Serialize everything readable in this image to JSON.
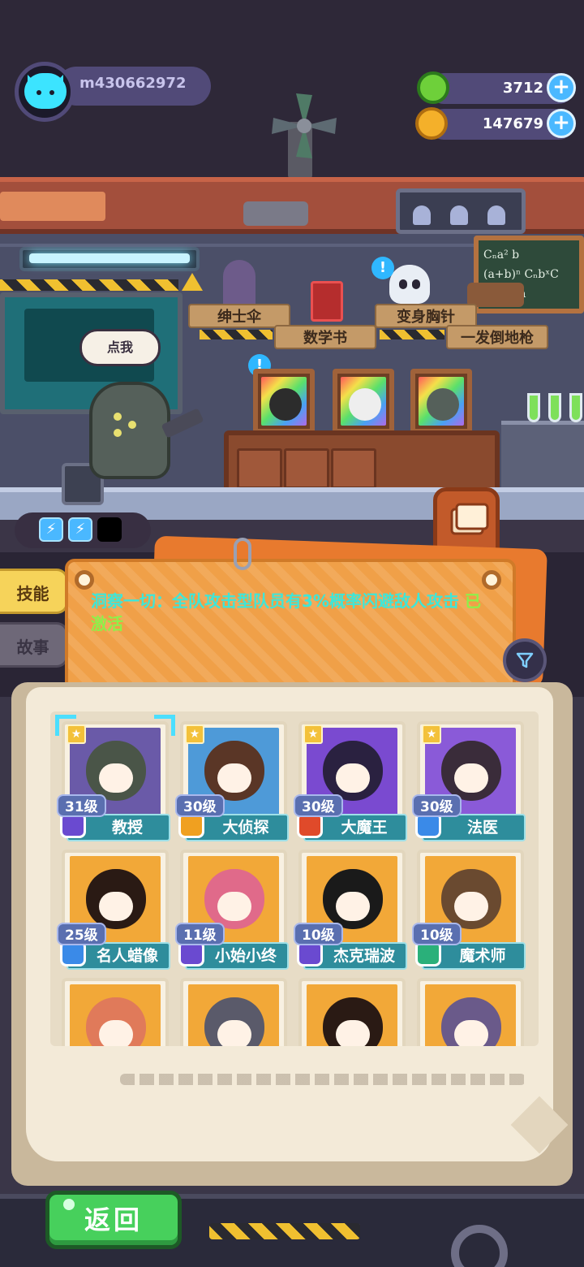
{
  "header": {
    "player_name": "m430662972",
    "resources": [
      {
        "icon": "green-gem-icon",
        "value": "3712"
      },
      {
        "icon": "gold-planet-coin-icon",
        "value": "147679"
      }
    ]
  },
  "scene": {
    "talk_bubble": "点我",
    "shelf_items": [
      "绅士伞",
      "数学书",
      "变身胸针",
      "一发倒地枪"
    ],
    "blackboard_lines": [
      "Cₙa² b",
      "(a+b)ⁿ  CₙbˣC",
      "a²b  Cₙa"
    ],
    "energy_slots": [
      "charged",
      "charged",
      "empty"
    ]
  },
  "side_tabs": {
    "skill": "技能",
    "story": "故事"
  },
  "skill": {
    "text": "洞察一切：全队攻击型队员有3%概率闪避敌人攻击",
    "status": "已激活"
  },
  "characters": [
    {
      "level": "31级",
      "name": "教授",
      "rank_color": "#6a4ad0",
      "art": "#6a5aa8",
      "hair": "#4a5548",
      "selected": true
    },
    {
      "level": "30级",
      "name": "大侦探",
      "rank_color": "#f0a020",
      "art": "#4e9ad8",
      "hair": "#5a3626",
      "selected": false
    },
    {
      "level": "30级",
      "name": "大魔王",
      "rank_color": "#e04a2a",
      "art": "#7a4ad0",
      "hair": "#2a2140",
      "selected": false
    },
    {
      "level": "30级",
      "name": "法医",
      "rank_color": "#3a8ae8",
      "art": "#8a5ad8",
      "hair": "#3a2c3a",
      "selected": false
    },
    {
      "level": "25级",
      "name": "名人蜡像",
      "rank_color": "#3a8ae8",
      "art": "#f2a838",
      "hair": "#2a1a14",
      "selected": false
    },
    {
      "level": "11级",
      "name": "小始小终",
      "rank_color": "#6a4ad0",
      "art": "#f2a838",
      "hair": "#e06a8a",
      "selected": false
    },
    {
      "level": "10级",
      "name": "杰克瑞波",
      "rank_color": "#6a4ad0",
      "art": "#f2a838",
      "hair": "#1a1a1a",
      "selected": false
    },
    {
      "level": "10级",
      "name": "魔术师",
      "rank_color": "#2ab07a",
      "art": "#f2a838",
      "hair": "#6a4a30",
      "selected": false
    },
    {
      "level": "",
      "name": "",
      "rank_color": "",
      "art": "#f2a838",
      "hair": "#e07a5a",
      "selected": false
    },
    {
      "level": "",
      "name": "",
      "rank_color": "",
      "art": "#f2a838",
      "hair": "#5a5a6a",
      "selected": false
    },
    {
      "level": "",
      "name": "",
      "rank_color": "",
      "art": "#f2a838",
      "hair": "#2a1a14",
      "selected": false
    },
    {
      "level": "",
      "name": "",
      "rank_color": "",
      "art": "#f2a838",
      "hair": "#6a5a8a",
      "selected": false
    }
  ],
  "bottom": {
    "back_label": "返回"
  }
}
